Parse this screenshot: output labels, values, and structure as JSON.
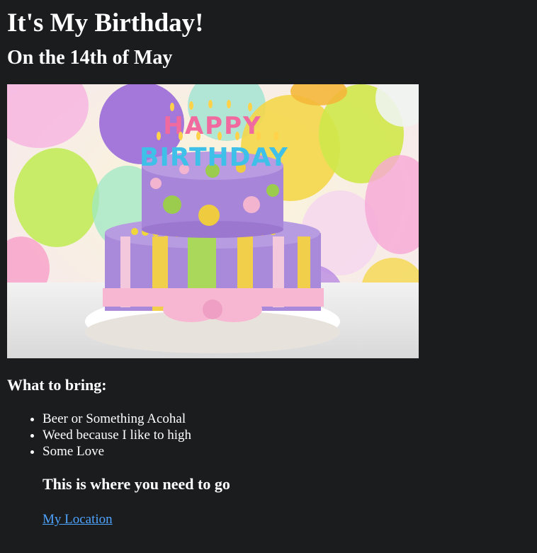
{
  "page": {
    "title": "It's My Birthday!",
    "subtitle": "On the 14th of May",
    "image": {
      "alt": "birthday-cake-photo",
      "cake_text": "HAPPY BIRTHDAY"
    },
    "bring_heading": "What to bring:",
    "bring_items": [
      "Beer or Something Acohal",
      "Weed because I like to high",
      "Some Love"
    ],
    "location_heading": "This is where you need to go",
    "location_link": "My Location",
    "colors": {
      "background": "#1b1c1e",
      "text": "#ffffff",
      "link": "#4ea3ff"
    }
  }
}
